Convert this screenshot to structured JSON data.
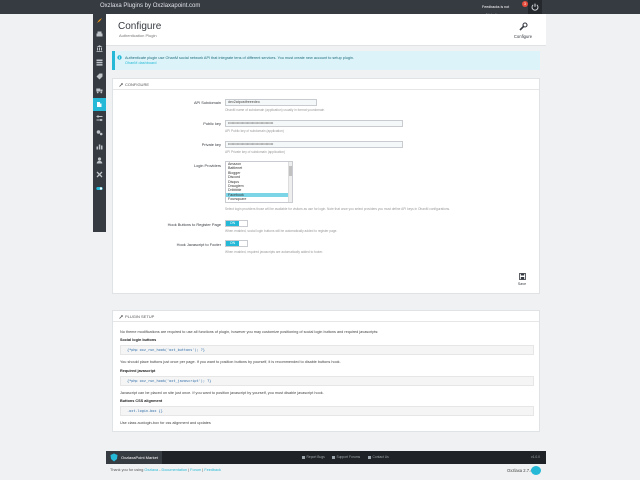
{
  "topbar": {
    "brand": "Oxzlaxa Plugins by Oxzlaxapoint.com",
    "feedback": "Feedbacks is not validated",
    "badge": "3"
  },
  "header": {
    "title": "Configure",
    "subtitle": "Authentication Plugin",
    "configure_label": "Configure"
  },
  "alert": {
    "text": "Authenticate plugin use OhanM social network API that integrate tens of different services. You must create new account to setup plugin.",
    "link": "OhanM dashboard"
  },
  "configure_panel": {
    "heading": "CONFIGURE",
    "fields": {
      "api_subdomain": {
        "label": "API Subdomain",
        "value": "dev2atpostfreeedeo",
        "help": "OhanM name of subdomain (application) usually in format yourdomain"
      },
      "public_key": {
        "label": "Public key",
        "value": "••••••••••••••••••••••••••••••••••••",
        "help": "API Public key of subdomain (application)"
      },
      "private_key": {
        "label": "Private key",
        "value": "••••••••••••••••••••••••••••••••••••",
        "help": "API Private key of subdomain (application)"
      },
      "login_providers": {
        "label": "Login Providers",
        "options": [
          "Amazon",
          "Battlenet",
          "Blogger",
          "Discord",
          "Disqus",
          "Draugiem",
          "Dribbble",
          "Facebook",
          "Foursquare"
        ],
        "selected": "Facebook",
        "help": "Select login providers those will be available for visitors as use for login. Note that once you select providers you must define API keys in OhanM configurations."
      },
      "hook_register": {
        "label": "Hook Buttons to Register Page",
        "value": "ON",
        "help": "When enabled, social login buttons will be automatically added to register page."
      },
      "hook_js": {
        "label": "Hook Javascript to Footer",
        "value": "ON",
        "help": "When enabled, required javascripts are automatically added to footer."
      }
    },
    "save_label": "Save"
  },
  "setup_panel": {
    "heading": "PLUGIN SETUP",
    "intro": "No theme modifications are required to use all functions of plugin, however you may customize positioning of social login buttons and required javascripts:",
    "social_heading": "Social login buttons",
    "social_code": "{*php oxz_run_hook('oxt_buttons'); ?}",
    "social_note": "You should place buttons just once per page. If you want to position buttons by yourself, it is recommended to disable buttons hook.",
    "js_heading": "Required javascript",
    "js_code": "{*php oxz_run_hook('oxt_javascript'); ?}",
    "js_note": "Javascript can be placed on site just once. If you want to position javascript by yourself, you must disable javascript hook.",
    "css_heading": "Buttons CSS alignment",
    "css_code": ".oxt-login-box {}",
    "css_note": "Use class auxlogin-box for css alignment and updates"
  },
  "footer": {
    "market": "OxzlaxaPoint Market",
    "links": [
      "Report Bugs",
      "Support Forums",
      "Contact Us"
    ],
    "time": "v1.0.0"
  },
  "credits": {
    "prefix": "Thank you for using",
    "brand": "Oxzlaxa",
    "links": [
      "Documentation",
      "Forum",
      "Feedback"
    ],
    "version": "Oxzlaxa 2.7.4"
  },
  "colors": {
    "accent": "#25b9d7",
    "dark": "#363a41",
    "alert_bg": "#dcf4f9"
  }
}
